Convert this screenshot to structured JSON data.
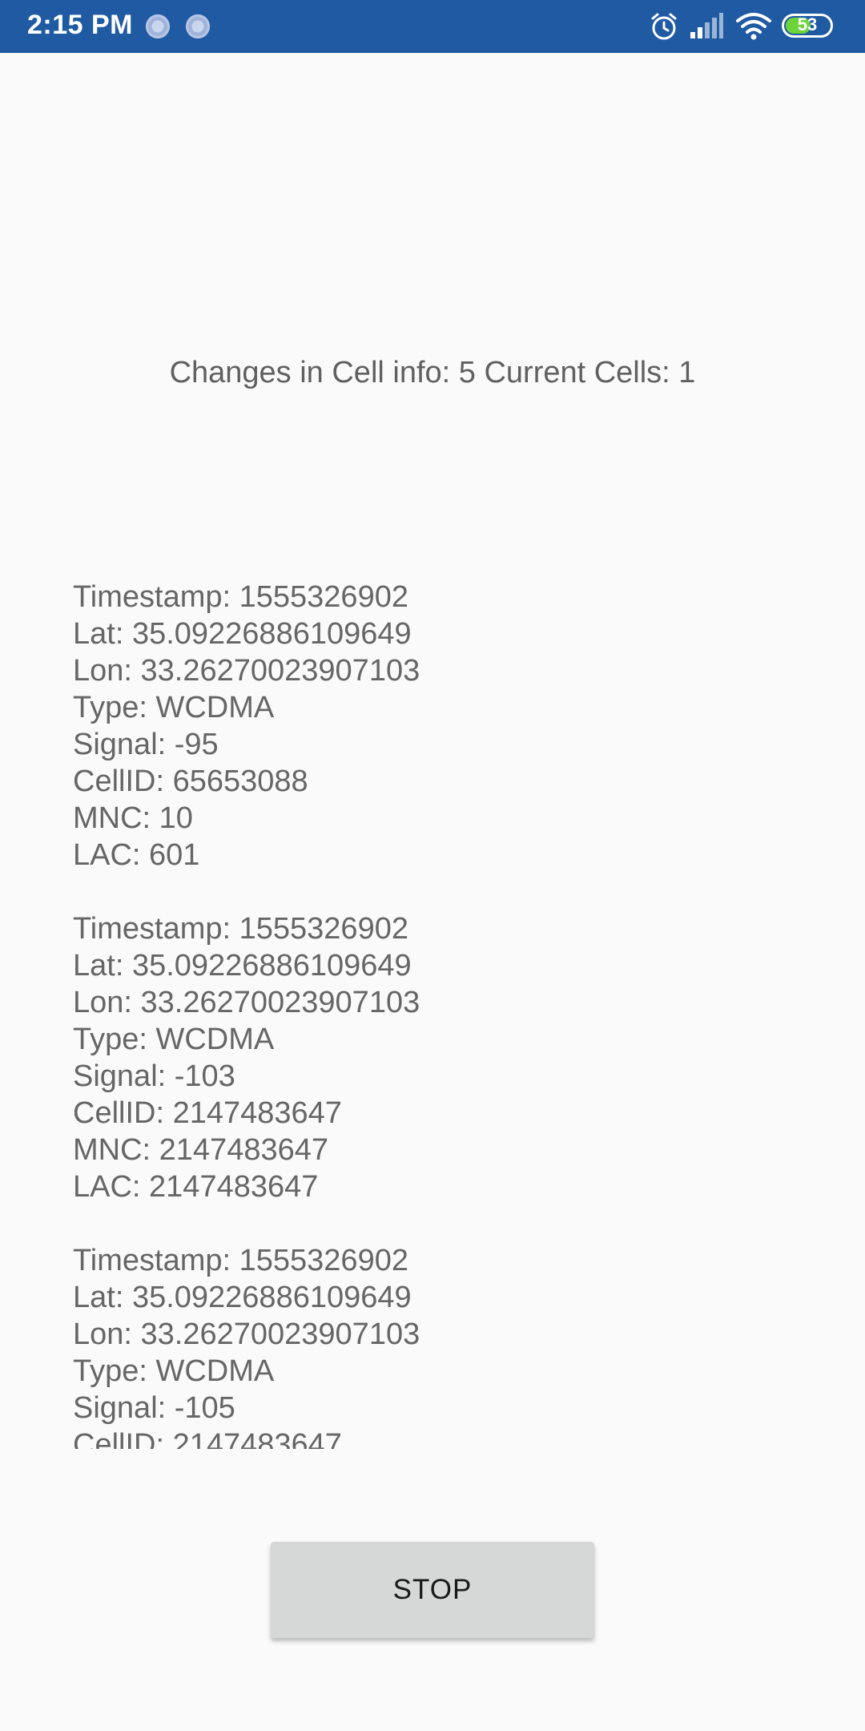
{
  "status_bar": {
    "time": "2:15 PM",
    "battery_level": "53",
    "background_color": "#1f5aa3",
    "battery_color": "#6cd43a",
    "icons": [
      "notification-dot-icon",
      "notification-dot-icon",
      "alarm-icon",
      "cellular-signal-icon",
      "wifi-icon",
      "battery-icon"
    ]
  },
  "summary": {
    "text": "Changes in Cell info: 5 Current Cells: 1"
  },
  "log": {
    "text": "Timestamp: 1555326902\nLat: 35.09226886109649\nLon: 33.26270023907103\nType: WCDMA\nSignal: -95\nCellID: 65653088\nMNC: 10\nLAC: 601\n\nTimestamp: 1555326902\nLat: 35.09226886109649\nLon: 33.26270023907103\nType: WCDMA\nSignal: -103\nCellID: 2147483647\nMNC: 2147483647\nLAC: 2147483647\n\nTimestamp: 1555326902\nLat: 35.09226886109649\nLon: 33.26270023907103\nType: WCDMA\nSignal: -105\nCellID: 2147483647"
  },
  "actions": {
    "stop_label": "STOP"
  }
}
